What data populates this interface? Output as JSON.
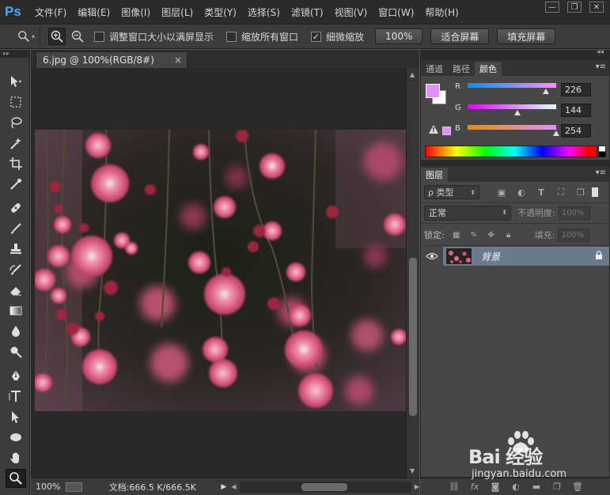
{
  "app": {
    "logo": "Ps"
  },
  "menu": [
    "文件(F)",
    "编辑(E)",
    "图像(I)",
    "图层(L)",
    "类型(Y)",
    "选择(S)",
    "滤镜(T)",
    "视图(V)",
    "窗口(W)",
    "帮助(H)"
  ],
  "window_controls": {
    "minimize": "—",
    "restore": "❐",
    "close": "✕"
  },
  "options": {
    "resize_windows": {
      "label": "调整窗口大小以满屏显示",
      "checked": false
    },
    "zoom_all": {
      "label": "缩放所有窗口",
      "checked": false
    },
    "scrubby_zoom": {
      "label": "细微缩放",
      "checked": true,
      "mark": "✓"
    },
    "btn_100": "100%",
    "btn_fit": "适合屏幕",
    "btn_fill": "填充屏幕"
  },
  "document": {
    "tab_title": "6.jpg @ 100%(RGB/8#)",
    "close": "×"
  },
  "status": {
    "zoom": "100%",
    "doc_size": "文档:666.5 K/666.5K",
    "arrow": "▶"
  },
  "color_panel": {
    "tabs": [
      "通道",
      "路径",
      "颜色"
    ],
    "active_tab": 2,
    "foreground": "#e290fe",
    "background": "#ffffff",
    "r_label": "R",
    "g_label": "G",
    "b_label": "B",
    "r": 226,
    "g": 144,
    "b": 254,
    "r_value": "226",
    "g_value": "144",
    "b_value": "254"
  },
  "layers_panel": {
    "title": "图层",
    "filter": "ρ 类型",
    "blend_mode": "正常",
    "opacity_label": "不透明度:",
    "opacity_value": "100%",
    "lock_label": "锁定:",
    "fill_label": "填充:",
    "fill_value": "100%",
    "layer_name": "背景"
  },
  "watermark": {
    "text": "Bai  经验",
    "url": "jingyan.baidu.com"
  }
}
